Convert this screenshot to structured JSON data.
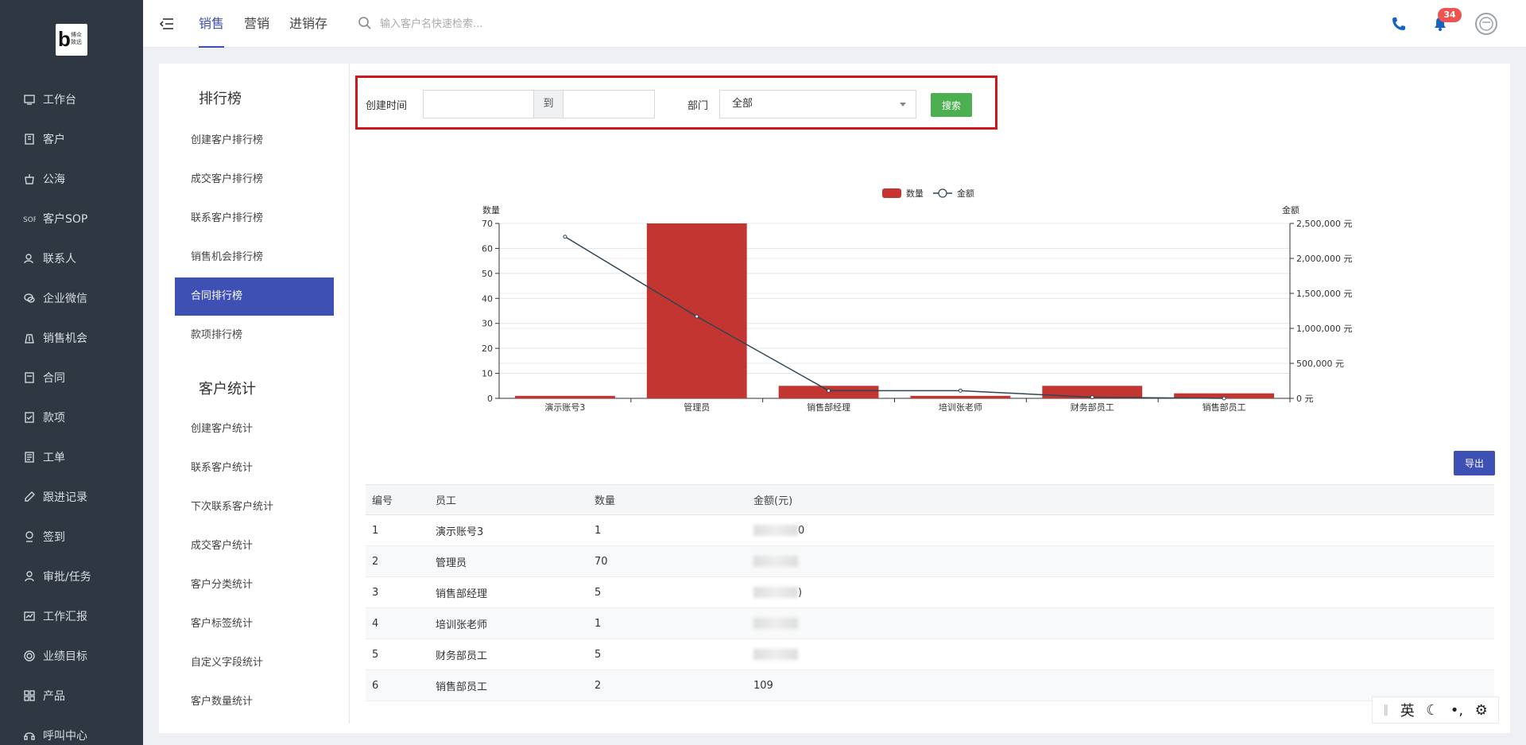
{
  "logo": {
    "letter": "b",
    "line1": "博众",
    "line2": "致远"
  },
  "sidebar": {
    "items": [
      {
        "label": "工作台",
        "icon": "monitor-icon"
      },
      {
        "label": "客户",
        "icon": "building-icon"
      },
      {
        "label": "公海",
        "icon": "pot-icon"
      },
      {
        "label": "客户SOP",
        "icon": "sop-icon"
      },
      {
        "label": "联系人",
        "icon": "contact-icon"
      },
      {
        "label": "企业微信",
        "icon": "wechat-icon"
      },
      {
        "label": "销售机会",
        "icon": "money-bag-icon"
      },
      {
        "label": "合同",
        "icon": "contract-icon"
      },
      {
        "label": "款项",
        "icon": "payment-icon"
      },
      {
        "label": "工单",
        "icon": "ticket-icon"
      },
      {
        "label": "跟进记录",
        "icon": "edit-icon"
      },
      {
        "label": "签到",
        "icon": "checkin-icon"
      },
      {
        "label": "审批/任务",
        "icon": "approval-icon"
      },
      {
        "label": "工作汇报",
        "icon": "report-icon"
      },
      {
        "label": "业绩目标",
        "icon": "target-icon"
      },
      {
        "label": "产品",
        "icon": "grid-icon"
      },
      {
        "label": "呼叫中心",
        "icon": "headset-icon"
      }
    ]
  },
  "topbar": {
    "tabs": [
      "销售",
      "营销",
      "进销存"
    ],
    "search_placeholder": "输入客户名快速检索...",
    "notification_count": "34"
  },
  "leftpanel": {
    "rank_title": "排行榜",
    "rank_items": [
      "创建客户排行榜",
      "成交客户排行榜",
      "联系客户排行榜",
      "销售机会排行榜",
      "合同排行榜",
      "款项排行榜"
    ],
    "stats_title": "客户统计",
    "stats_items": [
      "创建客户统计",
      "联系客户统计",
      "下次联系客户统计",
      "成交客户统计",
      "客户分类统计",
      "客户标签统计",
      "自定义字段统计",
      "客户数量统计"
    ]
  },
  "filter": {
    "created_label": "创建时间",
    "start_value": "",
    "to_label": "到",
    "end_value": "",
    "dept_label": "部门",
    "dept_value": "全部",
    "search_label": "搜索"
  },
  "chart_data": {
    "type": "bar",
    "categories": [
      "演示账号3",
      "管理员",
      "销售部经理",
      "培训张老师",
      "财务部员工",
      "销售部员工"
    ],
    "series": [
      {
        "name": "数量",
        "type": "bar",
        "axis": "left",
        "values": [
          1,
          70,
          5,
          1,
          5,
          2
        ],
        "color": "#c23531"
      },
      {
        "name": "金额",
        "type": "line",
        "axis": "right",
        "values": [
          2310000,
          1170000,
          110000,
          110000,
          15000,
          109
        ],
        "color": "#2f4554"
      }
    ],
    "ylabel_left": "数量",
    "ylabel_right": "金额",
    "ylim_left": [
      0,
      70
    ],
    "ylim_right": [
      0,
      2500000
    ],
    "left_ticks": [
      "0",
      "10",
      "20",
      "30",
      "40",
      "50",
      "60",
      "70"
    ],
    "right_ticks": [
      "0 元",
      "500,000 元",
      "1,000,000 元",
      "1,500,000 元",
      "2,000,000 元",
      "2,500,000 元"
    ],
    "legend_position": "top-center",
    "grid": true
  },
  "export_label": "导出",
  "table": {
    "headers": [
      "编号",
      "员工",
      "数量",
      "金额(元)"
    ],
    "rows": [
      {
        "no": "1",
        "name": "演示账号3",
        "count": "1",
        "amount": "0",
        "blurred": true
      },
      {
        "no": "2",
        "name": "管理员",
        "count": "70",
        "amount": "",
        "blurred": true
      },
      {
        "no": "3",
        "name": "销售部经理",
        "count": "5",
        "amount": ")",
        "blurred": true
      },
      {
        "no": "4",
        "name": "培训张老师",
        "count": "1",
        "amount": "",
        "blurred": true
      },
      {
        "no": "5",
        "name": "财务部员工",
        "count": "5",
        "amount": "",
        "blurred": true
      },
      {
        "no": "6",
        "name": "销售部员工",
        "count": "2",
        "amount": "109",
        "blurred": false
      }
    ]
  },
  "ime": {
    "lang": "英",
    "mode": "moon-icon",
    "punct": "•,",
    "settings": "gear-icon"
  }
}
